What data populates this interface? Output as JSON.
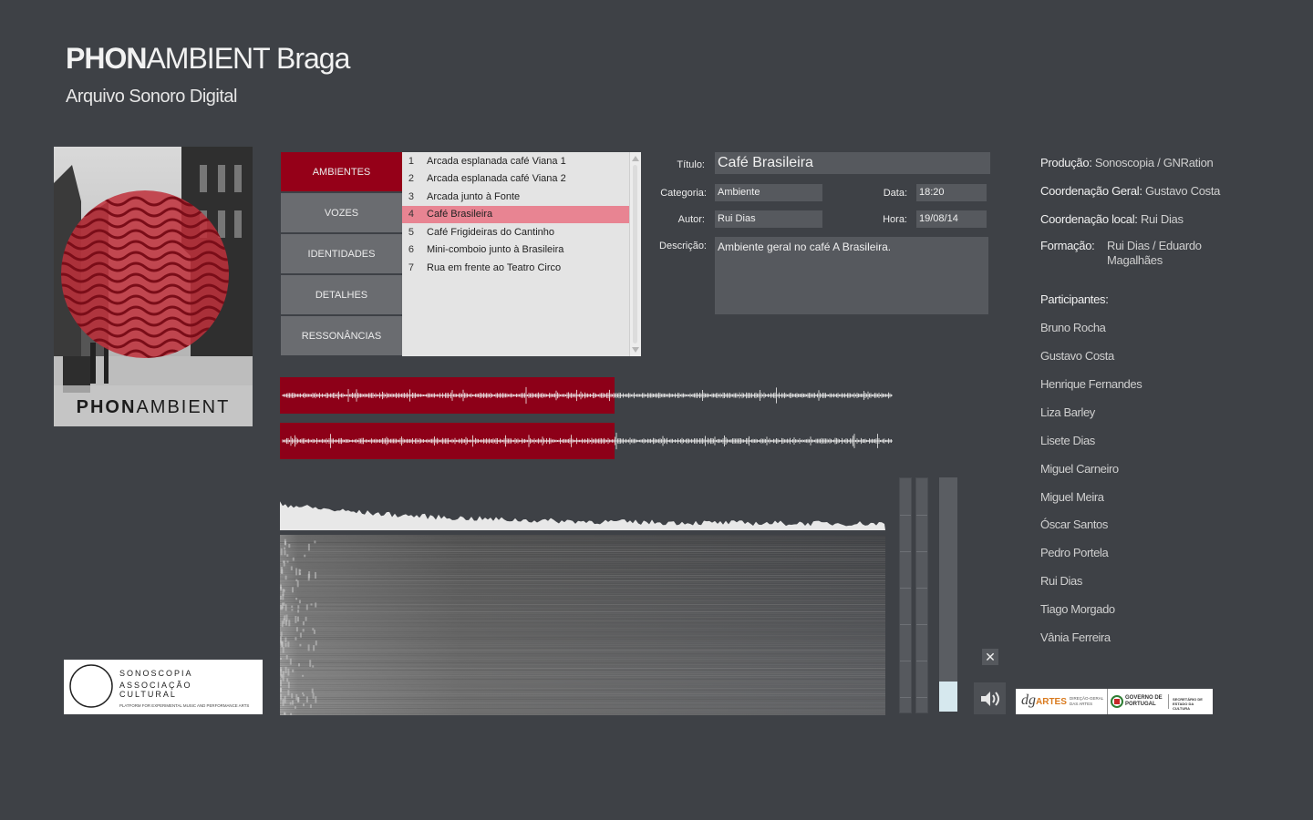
{
  "header": {
    "title_bold": "PHON",
    "title_light": "AMBIENT Braga",
    "subtitle": "Arquivo Sonoro Digital"
  },
  "cover": {
    "text_bold": "PHON",
    "text_light": "AMBIENT",
    "accent": "#b5202e"
  },
  "categories": [
    {
      "label": "AMBIENTES",
      "active": true
    },
    {
      "label": "VOZES",
      "active": false
    },
    {
      "label": "IDENTIDADES",
      "active": false
    },
    {
      "label": "DETALHES",
      "active": false
    },
    {
      "label": "RESSONÂNCIAS",
      "active": false
    }
  ],
  "tracks": [
    {
      "n": "1",
      "title": "Arcada esplanada café Viana 1"
    },
    {
      "n": "2",
      "title": "Arcada esplanada café Viana 2"
    },
    {
      "n": "3",
      "title": "Arcada junto à Fonte"
    },
    {
      "n": "4",
      "title": "Café Brasileira",
      "selected": true
    },
    {
      "n": "5",
      "title": "Café Frigideiras do Cantinho"
    },
    {
      "n": "6",
      "title": "Mini-comboio junto à Brasileira"
    },
    {
      "n": "7",
      "title": "Rua em frente ao Teatro Circo"
    }
  ],
  "details": {
    "titulo_label": "Título:",
    "titulo": "Café Brasileira",
    "categoria_label": "Categoria:",
    "categoria": "Ambiente",
    "autor_label": "Autor:",
    "autor": "Rui Dias",
    "data_label": "Data:",
    "data": "18:20",
    "hora_label": "Hora:",
    "hora": "19/08/14",
    "descricao_label": "Descrição:",
    "descricao": "Ambiente geral no café A Brasileira."
  },
  "credits": {
    "producao_label": "Produção:",
    "producao": "Sonoscopia / GNRation",
    "coord_geral_label": "Coordenação Geral:",
    "coord_geral": "Gustavo Costa",
    "coord_local_label": "Coordenação local:",
    "coord_local": "Rui Dias",
    "formacao_label": "Formação:",
    "formacao_1": "Rui Dias / Eduardo",
    "formacao_2": "Magalhães",
    "participantes_label": "Participantes:",
    "participantes": [
      "Bruno Rocha",
      "Gustavo Costa",
      "Henrique Fernandes",
      "Liza Barley",
      "Lisete Dias",
      "Miguel Carneiro",
      "Miguel Meira",
      "Óscar Santos",
      "Pedro Portela",
      "Rui Dias",
      "Tiago Morgado",
      "Vânia Ferreira"
    ]
  },
  "player": {
    "progress": 0.54,
    "volume": 0.13,
    "close_glyph": "✕",
    "wave_color": "#8d0018"
  },
  "logos": {
    "sonoscopia_name": "SONOSCOPIA",
    "sonoscopia_sub1": "ASSOCIAÇÃO",
    "sonoscopia_sub2": "CULTURAL",
    "sonoscopia_tagline": "PLATFORM FOR EXPERIMENTAL MUSIC AND PERFORMANCE ARTS",
    "dg": "dg",
    "artes": "ARTES",
    "dgartes_sub": "DIREÇÃO-GERAL DAS ARTES",
    "governo": "GOVERNO DE PORTUGAL",
    "secretario": "SECRETÁRIO DE ESTADO DA CULTURA"
  }
}
